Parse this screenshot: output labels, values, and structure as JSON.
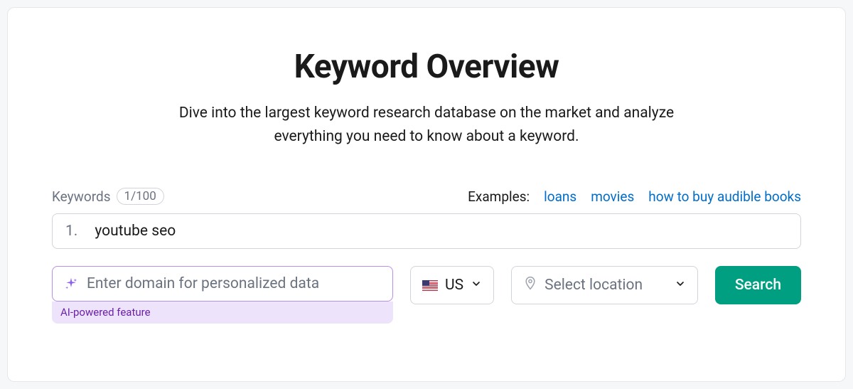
{
  "header": {
    "title": "Keyword Overview",
    "subtitle": "Dive into the largest keyword research database on the market and analyze everything you need to know about a keyword."
  },
  "keywords": {
    "label": "Keywords",
    "count": "1/100",
    "index": "1.",
    "value": "youtube seo"
  },
  "examples": {
    "label": "Examples:",
    "items": [
      "loans",
      "movies",
      "how to buy audible books"
    ]
  },
  "domain": {
    "placeholder": "Enter domain for personalized data",
    "caption": "AI-powered feature"
  },
  "country": {
    "code": "US"
  },
  "location": {
    "placeholder": "Select location"
  },
  "actions": {
    "search": "Search"
  }
}
